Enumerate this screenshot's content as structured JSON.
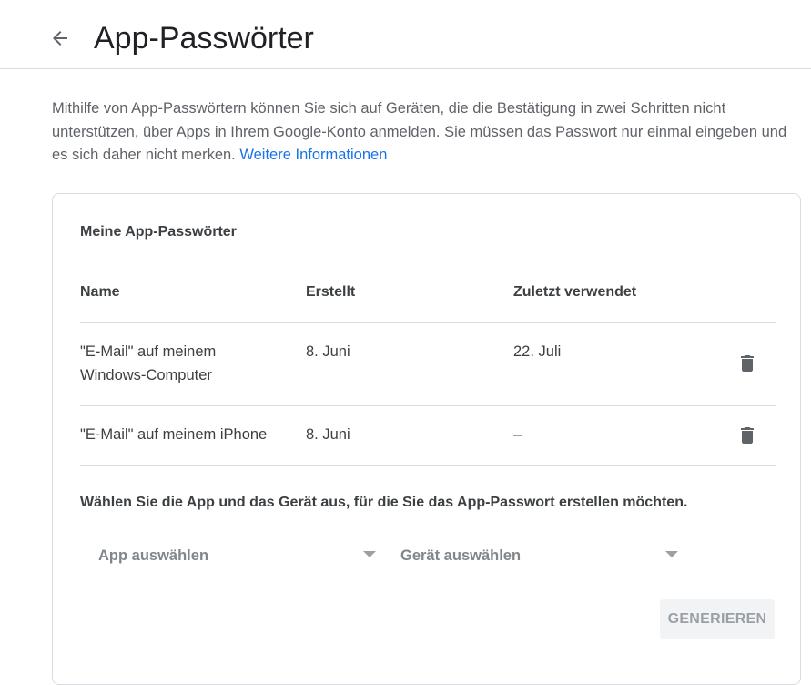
{
  "header": {
    "title": "App-Passwörter",
    "back_icon": "arrow-back-icon"
  },
  "intro": {
    "text": "Mithilfe von App-Passwörtern können Sie sich auf Geräten, die die Bestätigung in zwei Schritten nicht unterstützen, über Apps in Ihrem Google-Konto anmelden. Sie müssen das Passwort nur einmal eingeben und es sich daher nicht merken.",
    "link_text": "Weitere Informationen",
    "link_color": "#1a73e8"
  },
  "card": {
    "title": "Meine App-Passwörter",
    "columns": {
      "name": "Name",
      "created": "Erstellt",
      "last_used": "Zuletzt verwendet"
    },
    "rows": [
      {
        "name": "\"E-Mail\" auf meinem Windows-Computer",
        "created": "8. Juni",
        "last_used": "22. Juli",
        "action_icon": "trash-icon"
      },
      {
        "name": "\"E-Mail\" auf meinem iPhone",
        "created": "8. Juni",
        "last_used": "–",
        "action_icon": "trash-icon"
      }
    ],
    "prompt": "Wählen Sie die App und das Gerät aus, für die Sie das App-Passwort erstellen möchten.",
    "app_select": {
      "value": "App auswählen",
      "icon": "dropdown-arrow-icon"
    },
    "device_select": {
      "value": "Gerät auswählen",
      "icon": "dropdown-arrow-icon"
    },
    "generate_button": {
      "label": "GENERIEREN",
      "state": "disabled"
    }
  }
}
